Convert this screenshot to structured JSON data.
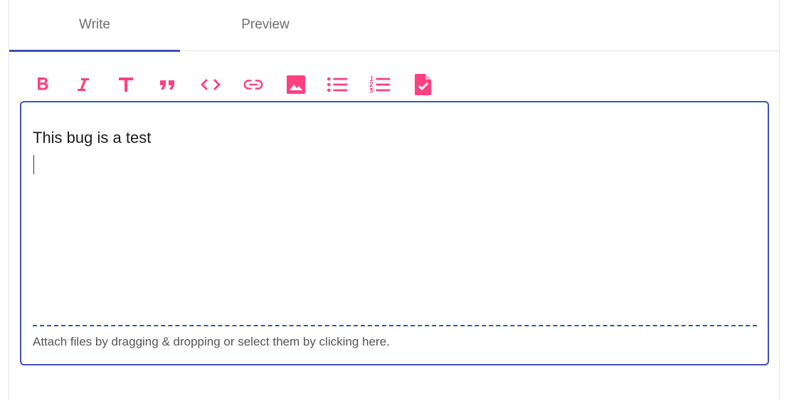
{
  "tabs": [
    {
      "label": "Write",
      "active": true
    },
    {
      "label": "Preview",
      "active": false
    }
  ],
  "toolbar": {
    "accent_color": "#ff4081",
    "buttons": [
      {
        "icon": "bold-icon"
      },
      {
        "icon": "italic-icon"
      },
      {
        "icon": "heading-icon"
      },
      {
        "icon": "quote-icon"
      },
      {
        "icon": "code-icon"
      },
      {
        "icon": "link-icon"
      },
      {
        "icon": "image-icon"
      },
      {
        "icon": "bulleted-list-icon"
      },
      {
        "icon": "numbered-list-icon"
      },
      {
        "icon": "task-list-icon"
      }
    ]
  },
  "editor": {
    "value": "This bug is a test",
    "border_color": "#3f51b5"
  },
  "attachments": {
    "hint": "Attach files by dragging & dropping or select them by clicking here."
  }
}
